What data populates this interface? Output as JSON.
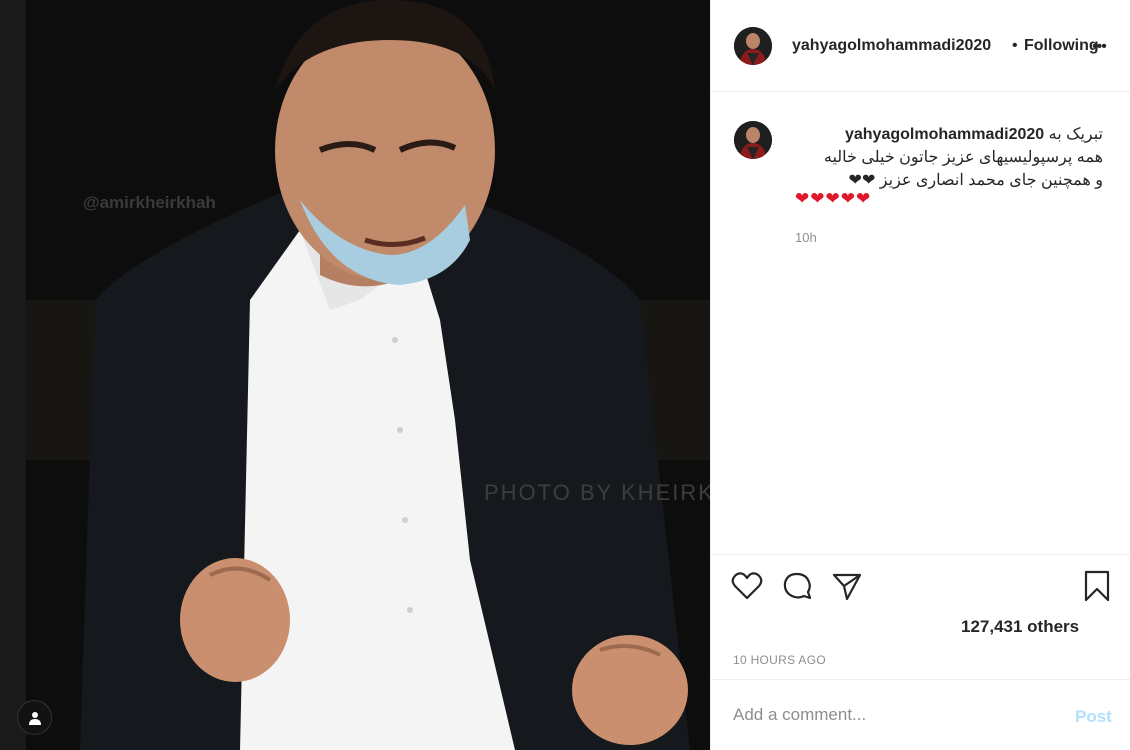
{
  "post": {
    "watermark_top": "@amirkheirkhah",
    "watermark_mid": "PHOTO BY KHEIRKHAH"
  },
  "header": {
    "username": "yahyagolmohammadi2020",
    "separator": "•",
    "follow_label": "Following",
    "more_label": "•••"
  },
  "caption": {
    "username": "yahyagolmohammadi2020",
    "line1": "تبریک به",
    "line2": "همه پرسپولیسیهای عزیز جاتون خیلی خالیه",
    "line3": "و همچنین جای محمد انصاری عزیز ❤❤",
    "line4": "❤❤❤❤❤",
    "time": "10h"
  },
  "actions": {
    "likes": "127,431 others",
    "timestamp": "10 HOURS AGO"
  },
  "comment": {
    "placeholder": "Add a comment...",
    "post_label": "Post"
  },
  "colors": {
    "heart": "#e0182d",
    "post_disabled": "#b2dffc",
    "muted": "#8e8e8e"
  }
}
